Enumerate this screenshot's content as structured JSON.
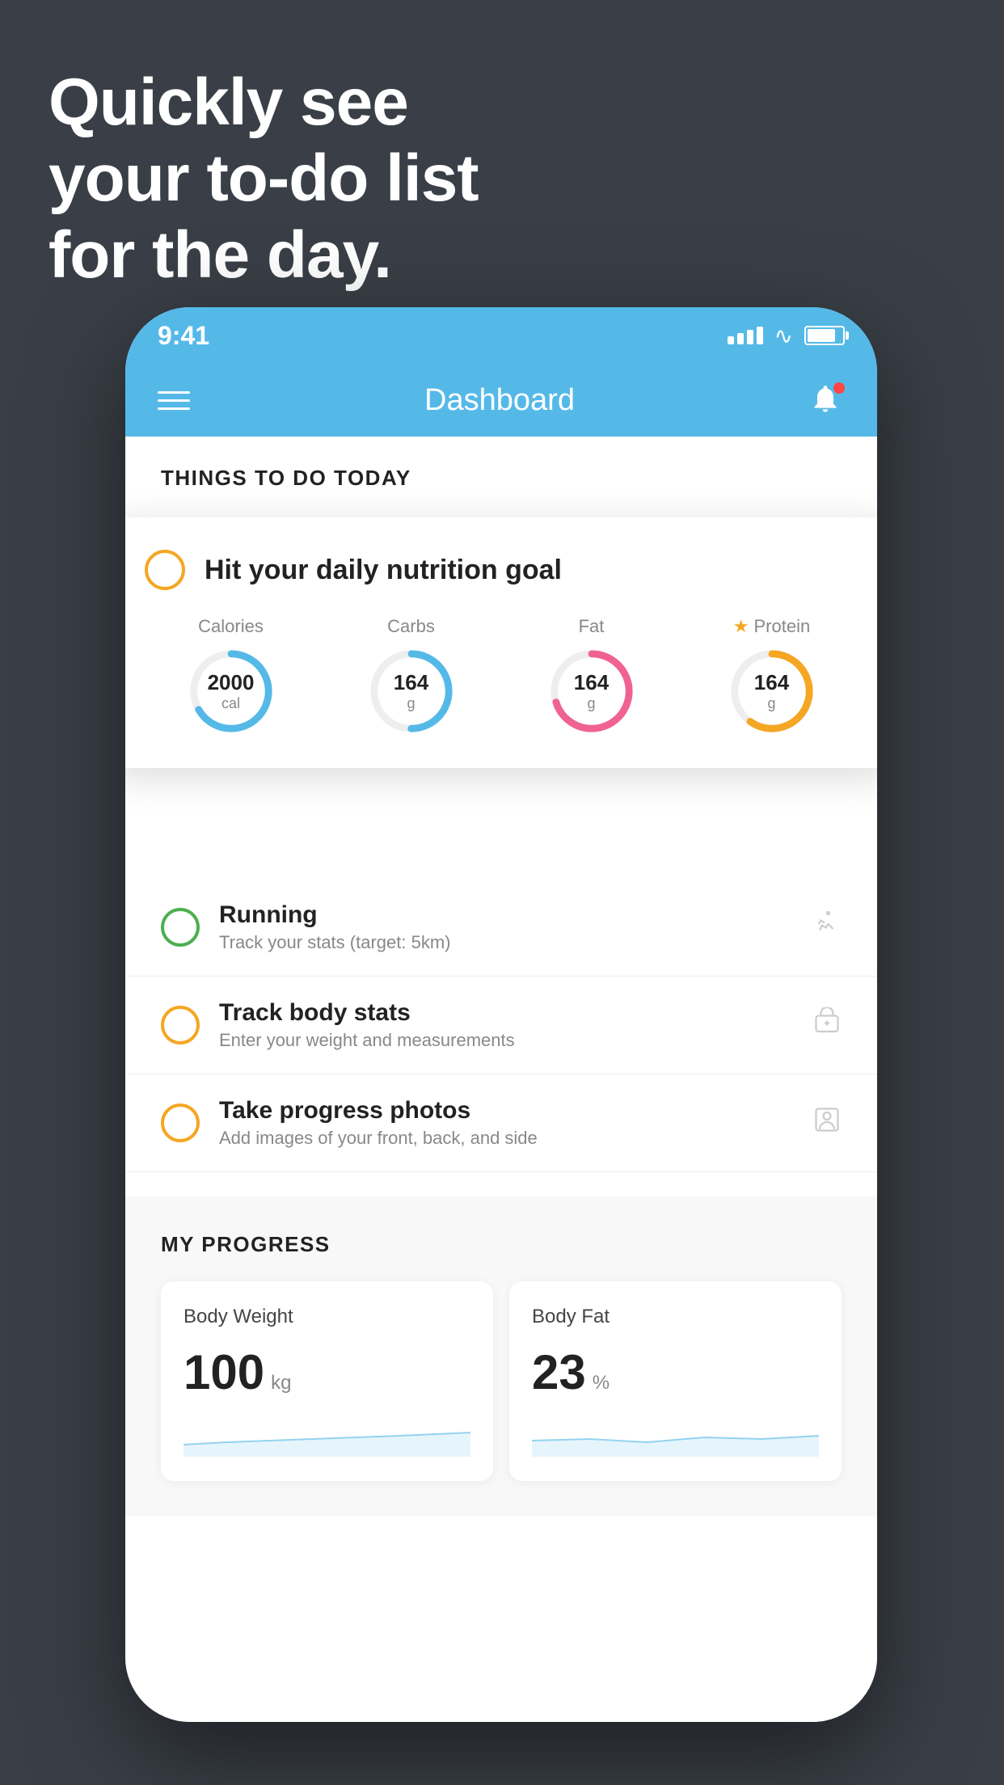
{
  "hero": {
    "line1": "Quickly see",
    "line2": "your to-do list",
    "line3": "for the day."
  },
  "status_bar": {
    "time": "9:41"
  },
  "nav": {
    "title": "Dashboard"
  },
  "things_section": {
    "header": "THINGS TO DO TODAY"
  },
  "floating_card": {
    "title": "Hit your daily nutrition goal",
    "stats": [
      {
        "label": "Calories",
        "value": "2000",
        "unit": "cal",
        "color": "blue",
        "progress": 0.65
      },
      {
        "label": "Carbs",
        "value": "164",
        "unit": "g",
        "color": "blue",
        "progress": 0.5
      },
      {
        "label": "Fat",
        "value": "164",
        "unit": "g",
        "color": "pink",
        "progress": 0.7
      },
      {
        "label": "Protein",
        "value": "164",
        "unit": "g",
        "color": "yellow",
        "progress": 0.6,
        "star": true
      }
    ]
  },
  "todo_items": [
    {
      "name": "Running",
      "desc": "Track your stats (target: 5km)",
      "circle_color": "green",
      "icon": "🥿"
    },
    {
      "name": "Track body stats",
      "desc": "Enter your weight and measurements",
      "circle_color": "yellow",
      "icon": "⚖"
    },
    {
      "name": "Take progress photos",
      "desc": "Add images of your front, back, and side",
      "circle_color": "yellow",
      "icon": "👤"
    }
  ],
  "progress_section": {
    "title": "MY PROGRESS",
    "cards": [
      {
        "title": "Body Weight",
        "value": "100",
        "unit": "kg"
      },
      {
        "title": "Body Fat",
        "value": "23",
        "unit": "%"
      }
    ]
  }
}
